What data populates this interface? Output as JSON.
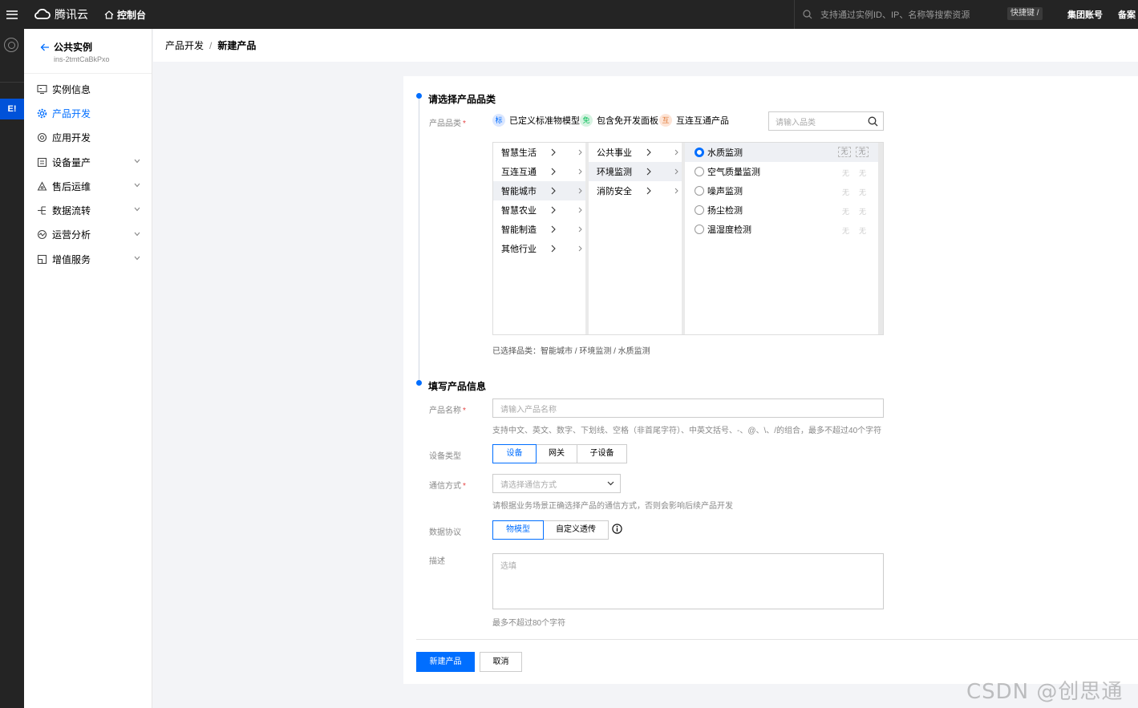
{
  "topbar": {
    "brand": "腾讯云",
    "console": "控制台",
    "search_placeholder": "支持通过实例ID、IP、名称等搜索资源",
    "shortcut": "快捷键 /",
    "group_account": "集团账号",
    "beian": "备案"
  },
  "rail": {
    "active_label": "E!"
  },
  "sidebar": {
    "instance_title": "公共实例",
    "instance_id": "ins-2tmtCaBkPxo",
    "items": [
      {
        "label": "实例信息"
      },
      {
        "label": "产品开发"
      },
      {
        "label": "应用开发"
      },
      {
        "label": "设备量产"
      },
      {
        "label": "售后运维"
      },
      {
        "label": "数据流转"
      },
      {
        "label": "运营分析"
      },
      {
        "label": "增值服务"
      }
    ]
  },
  "breadcrumb": {
    "parent": "产品开发",
    "separator": "/",
    "current": "新建产品"
  },
  "section1": {
    "title": "请选择产品品类",
    "label": "产品品类",
    "required_mark": "*",
    "tags": [
      {
        "badge": "标",
        "text": "已定义标准物模型"
      },
      {
        "badge": "免",
        "text": "包含免开发面板"
      },
      {
        "badge": "互",
        "text": "互连互通产品"
      }
    ],
    "search_placeholder": "请输入品类",
    "col1": [
      "智慧生活",
      "互连互通",
      "智能城市",
      "智慧农业",
      "智能制造",
      "其他行业"
    ],
    "col2": [
      "公共事业",
      "环境监测",
      "消防安全"
    ],
    "col3": [
      {
        "label": "水质监测",
        "a": "无",
        "b": "无"
      },
      {
        "label": "空气质量监测",
        "a": "无",
        "b": "无"
      },
      {
        "label": "噪声监测",
        "a": "无",
        "b": "无"
      },
      {
        "label": "扬尘检测",
        "a": "无",
        "b": "无"
      },
      {
        "label": "温湿度检测",
        "a": "无",
        "b": "无"
      }
    ],
    "selected_text": "已选择品类：智能城市 / 环境监测 / 水质监测"
  },
  "section2": {
    "title": "填写产品信息",
    "name_label": "产品名称",
    "name_placeholder": "请输入产品名称",
    "name_help": "支持中文、英文、数字、下划线、空格（非首尾字符）、中英文括号、-、@、\\、/的组合，最多不超过40个字符",
    "device_type_label": "设备类型",
    "device_types": [
      "设备",
      "网关",
      "子设备"
    ],
    "comm_label": "通信方式",
    "comm_placeholder": "请选择通信方式",
    "comm_help": "请根据业务场景正确选择产品的通信方式，否则会影响后续产品开发",
    "protocol_label": "数据协议",
    "protocols": [
      "物模型",
      "自定义透传"
    ],
    "desc_label": "描述",
    "desc_placeholder": "选填",
    "desc_help": "最多不超过80个字符"
  },
  "actions": {
    "create": "新建产品",
    "cancel": "取消"
  },
  "watermark": "CSDN @创思通信",
  "colors": {
    "primary": "#006eff",
    "topbar": "#242424",
    "rail_active": "#0052d9"
  }
}
